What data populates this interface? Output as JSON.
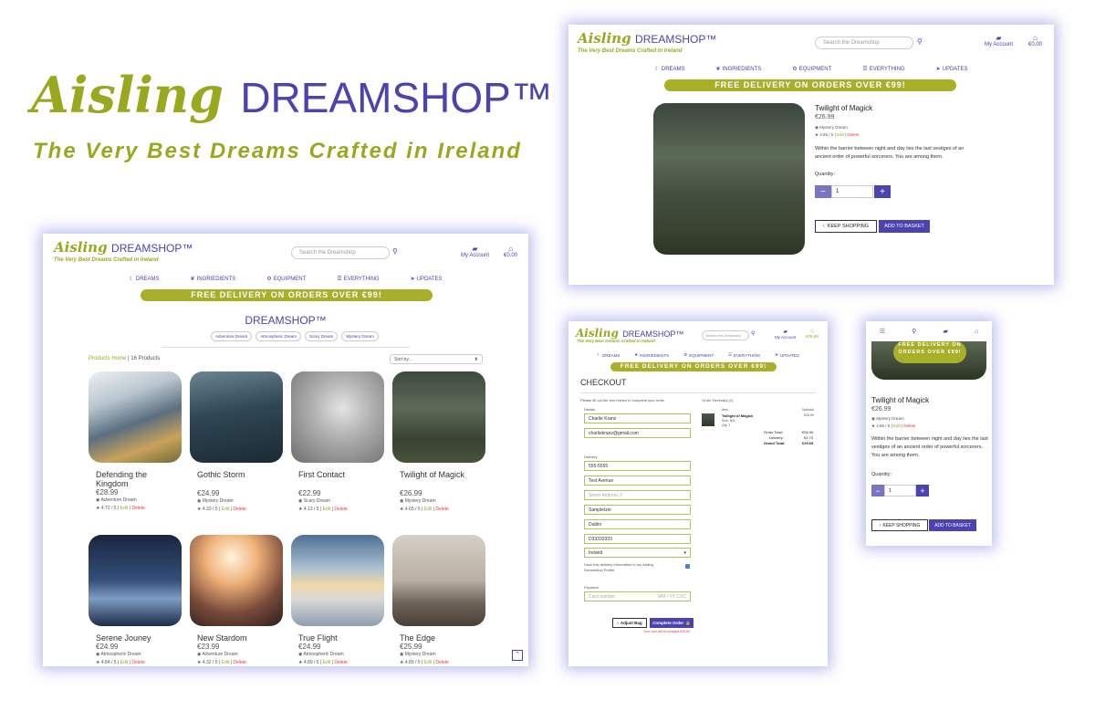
{
  "brand": {
    "a": "Aisling",
    "d": "DREAMSHOP™",
    "tagline": "The Very Best Dreams Crafted in Ireland"
  },
  "nav": {
    "dreams": "DREAMS",
    "ingredients": "INGRIEDIENTS",
    "equipment": "EQUIPMENT",
    "everything": "EVERYTHING",
    "updates": "UPDATES"
  },
  "banner": "FREE DELIVERY ON ORDERS OVER €99!",
  "search_placeholder": "Search the Dreamshop",
  "search_placeholder_short": "Search the Dreamsho",
  "account": "My Account",
  "basket_total": "€0.00",
  "basket_total_checkout": "€29.69",
  "shop": {
    "title": "DREAMSHOP™",
    "categories": [
      "Adventure Dream",
      "Atmospheric Dream",
      "Scary Dream",
      "Mystery Dream"
    ],
    "crumb_link": "Products Home",
    "crumb_rest": " | 16 Products",
    "sort": "Sort by...",
    "edit": "Edit",
    "delete": "Delete",
    "products": [
      {
        "name": "Defending the Kingdom",
        "price": "€28.99",
        "cat": "Adventure Dream",
        "rating": "4.72 / 5"
      },
      {
        "name": "Gothic Storm",
        "price": "€24.99",
        "cat": "Mystery Dream",
        "rating": "4.33 / 5"
      },
      {
        "name": "First Contact",
        "price": "€22.99",
        "cat": "Scary Dream",
        "rating": "4.13 / 5"
      },
      {
        "name": "Twilight of Magick",
        "price": "€26.99",
        "cat": "Mystery Dream",
        "rating": "4.65 / 5"
      },
      {
        "name": "Serene Jouney",
        "price": "€24.99",
        "cat": "Atmospheric Dream",
        "rating": "4.84 / 5"
      },
      {
        "name": "New Stardom",
        "price": "€23.99",
        "cat": "Adventure Dream",
        "rating": "4.32 / 5"
      },
      {
        "name": "True Flight",
        "price": "€24.99",
        "cat": "Atmospheric Dream",
        "rating": "4.89 / 5"
      },
      {
        "name": "The Edge",
        "price": "€25.99",
        "cat": "Mystery Dream",
        "rating": "4.89 / 5"
      }
    ]
  },
  "detail": {
    "name": "Twilight of Magick",
    "price": "€26.99",
    "cat": "Mystery Dream",
    "rating": "4.65 / 5",
    "edit": "Edit",
    "delete": "Delete",
    "desc": "Within the barrier between night and day lies the last vestiges of an ancient order of powerful sorcerers. You are among them.",
    "qty_label": "Quantity:",
    "qty": "1",
    "keep": "KEEP SHOPPING",
    "add": "ADD TO BASKET"
  },
  "mobile": {
    "banner": "FREE DELIVERY ON ORDERS OVER €99!",
    "qty_label": "Quantity:"
  },
  "checkout": {
    "title": "CHECKOUT",
    "intro": "Please fill out the form below to complete your order",
    "details": "Details",
    "name": "Charlie Kranz",
    "email": "charliekranz@gmail.com",
    "delivery": "Delivery",
    "phone": "555-5555",
    "street1": "Test Avenue",
    "street2": "Street Address 2",
    "town": "Sampletzie",
    "county": "Dublin",
    "postcode": "D33333333",
    "country": "Ireland",
    "save": "Save this delivery information to my Aisling Dreamshop Profile",
    "payment": "Payment",
    "card": "Card number",
    "card_exp": "MM / YY  CVC",
    "summary": "Order Summary (1)",
    "item_h": "Item",
    "sub_h": "Subtotal",
    "item_name": "Twilight of Magick",
    "item_size": "Size: N/A",
    "item_qty": "Qty: 1",
    "item_sub": "€26.99",
    "order_total_l": "Order Total:",
    "order_total": "€26.99",
    "delivery_l": "Delivery:",
    "delivery_v": "€2.70",
    "grand_l": "Grand Total:",
    "grand": "€29.69",
    "adjust": "Adjust Bag",
    "complete": "Complete Order",
    "charge": "Your card will be charged €29.69"
  },
  "colors": {
    "brand": "#4a43b0",
    "accent": "#9aa820",
    "banner": "#a8b02a"
  }
}
